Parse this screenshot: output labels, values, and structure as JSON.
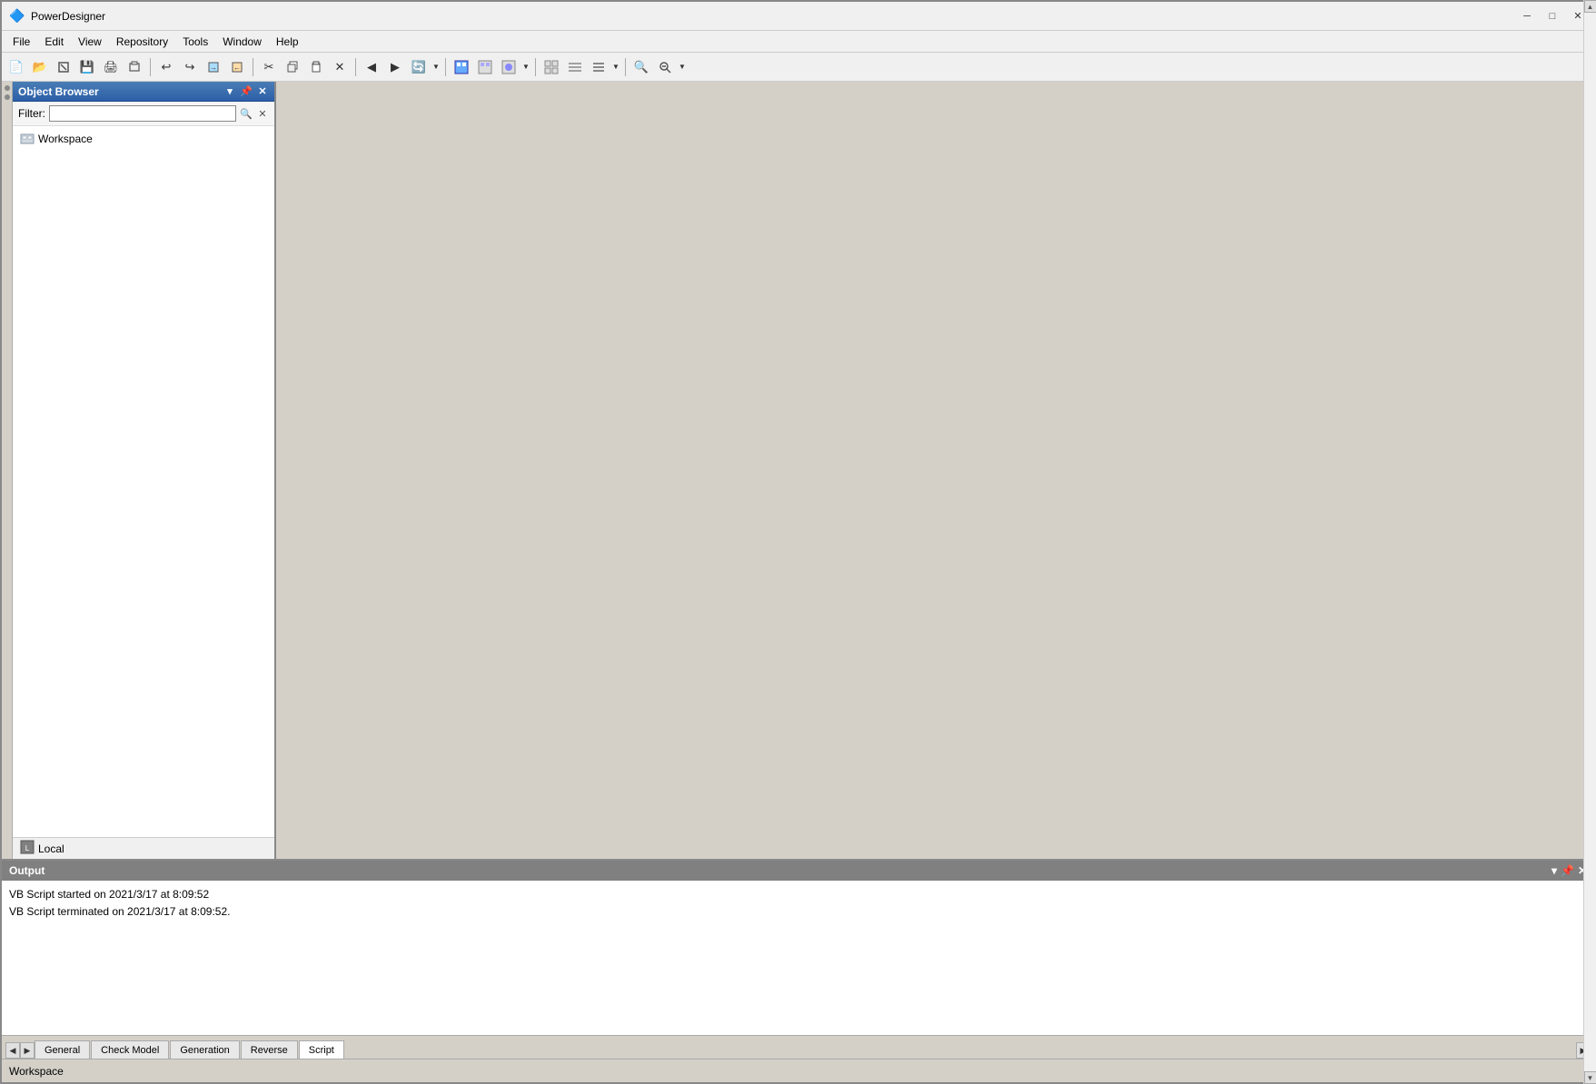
{
  "app": {
    "title": "PowerDesigner",
    "icon": "🔷"
  },
  "window_controls": {
    "minimize": "─",
    "maximize": "□",
    "close": "✕"
  },
  "menu": {
    "items": [
      "File",
      "Edit",
      "View",
      "Repository",
      "Tools",
      "Window",
      "Help"
    ]
  },
  "toolbar": {
    "groups": [
      [
        "new",
        "open",
        "close",
        "save",
        "print",
        "print-preview"
      ],
      [
        "cut",
        "copy",
        "paste",
        "delete"
      ],
      [
        "undo",
        "redo",
        "export",
        "import"
      ],
      [
        "diagram1",
        "diagram2",
        "diagram3"
      ],
      [
        "view1",
        "view2",
        "view3"
      ],
      [
        "zoom-in",
        "zoom-out"
      ]
    ]
  },
  "object_browser": {
    "title": "Object Browser",
    "filter_label": "Filter:",
    "filter_placeholder": "",
    "tree": [
      {
        "label": "Workspace",
        "icon": "workspace",
        "level": 0
      }
    ],
    "footer": {
      "icon": "local",
      "label": "Local"
    }
  },
  "output": {
    "title": "Output",
    "lines": [
      "VB Script started on 2021/3/17 at 8:09:52",
      "VB Script terminated on 2021/3/17 at 8:09:52."
    ]
  },
  "tabs": {
    "items": [
      "General",
      "Check Model",
      "Generation",
      "Reverse",
      "Script"
    ],
    "active": "Script"
  },
  "status_bar": {
    "text": "Workspace"
  }
}
